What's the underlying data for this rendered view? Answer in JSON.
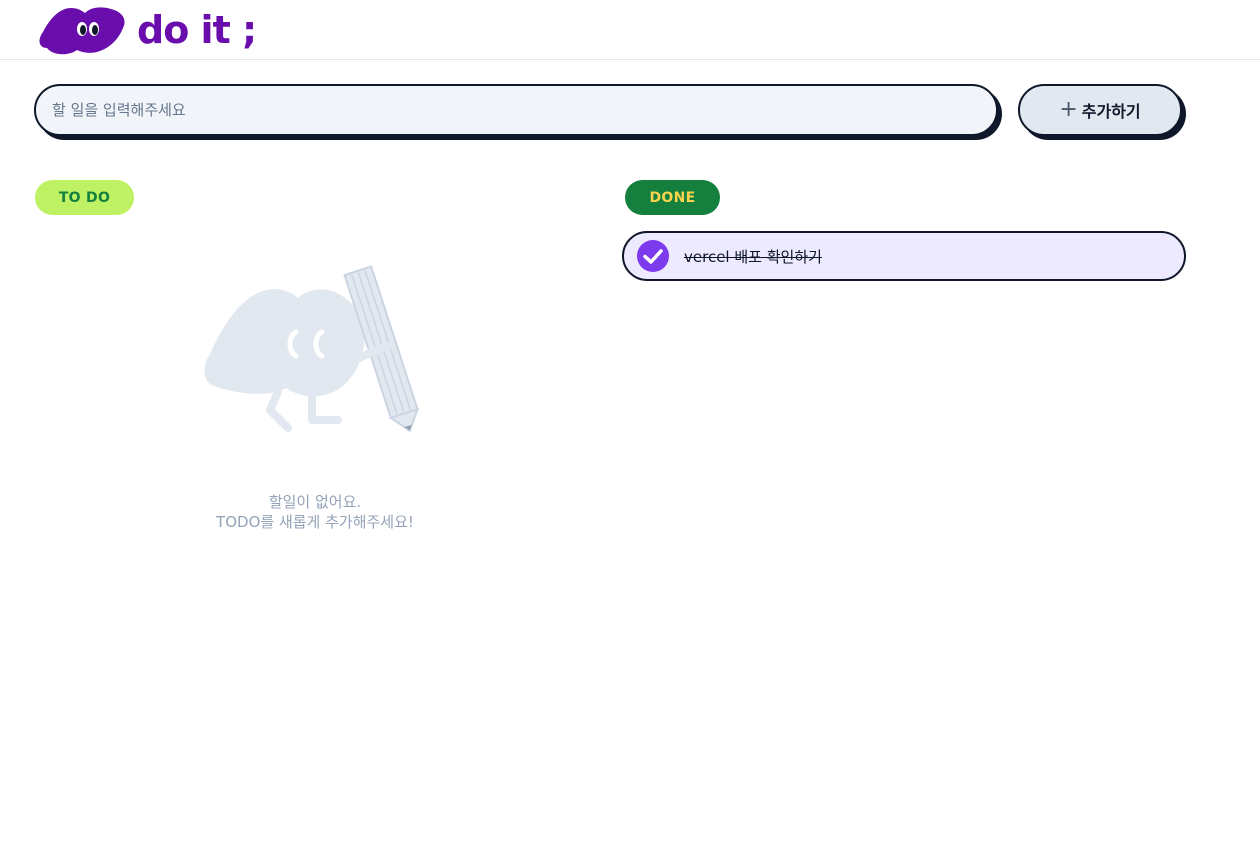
{
  "header": {
    "logo_text": "do it ;",
    "logo_icon": "cloud-character-icon",
    "brand_color": "#6a0dad"
  },
  "search": {
    "placeholder": "할 일을 입력해주세요",
    "value": ""
  },
  "add_button": {
    "icon": "plus-icon",
    "icon_glyph": "+",
    "label": "추가하기"
  },
  "todo_section": {
    "badge": "TO DO",
    "badge_bg": "#bef264",
    "badge_fg": "#15803d",
    "empty_icon": "cloud-pencil-illustration",
    "empty_line1": "할일이 없어요.",
    "empty_line2": "TODO를 새롭게 추가해주세요!"
  },
  "done_section": {
    "badge": "DONE",
    "badge_bg": "#15803d",
    "badge_fg": "#fcd34d",
    "items": [
      {
        "label": "vercel 배포 확인하기",
        "checked": true,
        "icon": "checked-circle-icon"
      }
    ]
  }
}
